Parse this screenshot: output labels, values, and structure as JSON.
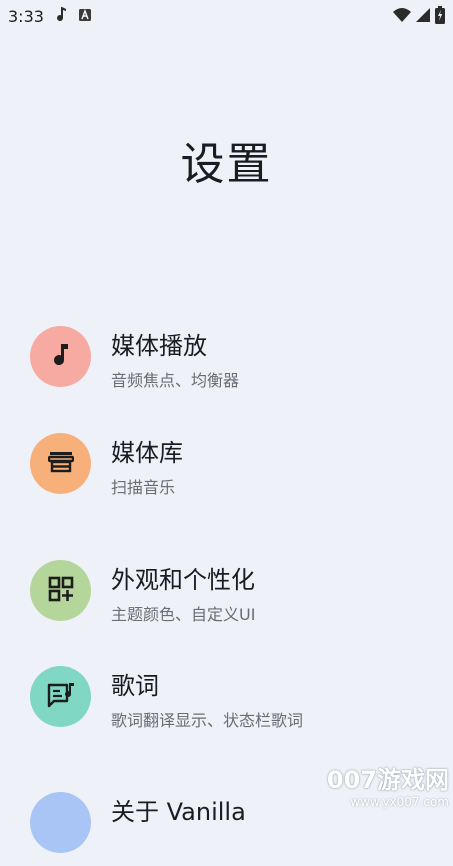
{
  "status_bar": {
    "time": "3:33",
    "left_icons": [
      "music-note-icon",
      "font-a-icon"
    ],
    "right_icons": [
      "wifi-icon",
      "signal-icon",
      "battery-charging-icon"
    ]
  },
  "page": {
    "title": "设置"
  },
  "settings_items": [
    {
      "title": "媒体播放",
      "subtitle": "音频焦点、均衡器",
      "icon": "music-note-icon",
      "color": "#f6aaa2"
    },
    {
      "title": "媒体库",
      "subtitle": "扫描音乐",
      "icon": "storefront-icon",
      "color": "#f8b07a"
    },
    {
      "title": "外观和个性化",
      "subtitle": "主题颜色、自定义UI",
      "icon": "grid-add-icon",
      "color": "#b5d69a"
    },
    {
      "title": "歌词",
      "subtitle": "歌词翻译显示、状态栏歌词",
      "icon": "lyrics-icon",
      "color": "#7fd7c4"
    },
    {
      "title": "关于 Vanilla",
      "subtitle": "",
      "icon": "info-icon",
      "color": "#a9c5f5"
    }
  ],
  "watermark": {
    "main": "007游戏网",
    "url": "www.yx007.com"
  }
}
